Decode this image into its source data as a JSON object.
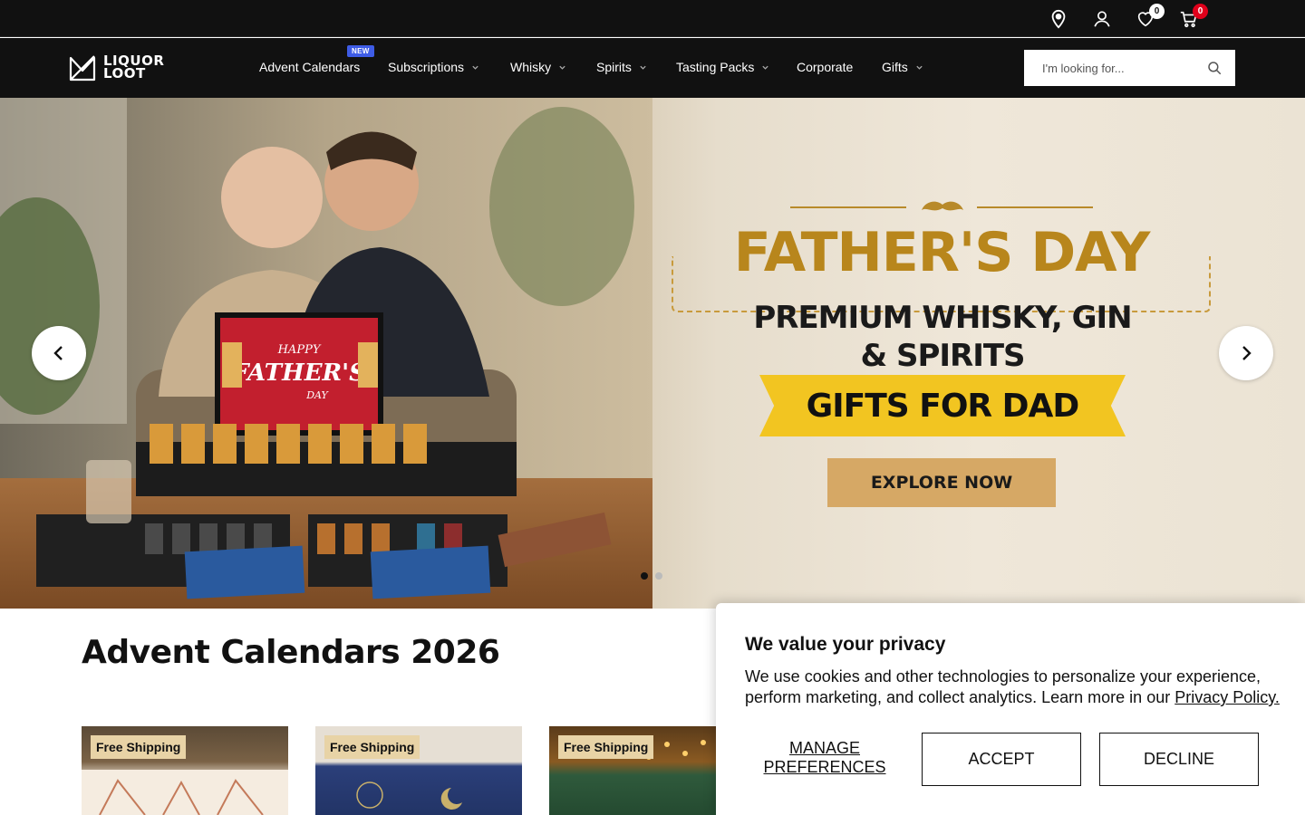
{
  "utility_bar": {
    "wishlist_count": "0",
    "cart_count": "0",
    "icons": [
      "location-icon",
      "account-icon",
      "heart-icon",
      "cart-icon"
    ]
  },
  "nav": {
    "logo_line1": "LIQUOR",
    "logo_line2": "LOOT",
    "new_badge": "NEW",
    "items": [
      {
        "label": "Advent Calendars",
        "has_dropdown": false
      },
      {
        "label": "Subscriptions",
        "has_dropdown": true
      },
      {
        "label": "Whisky",
        "has_dropdown": true
      },
      {
        "label": "Spirits",
        "has_dropdown": true
      },
      {
        "label": "Tasting Packs",
        "has_dropdown": true
      },
      {
        "label": "Corporate",
        "has_dropdown": false
      },
      {
        "label": "Gifts",
        "has_dropdown": true
      }
    ],
    "search_placeholder": "I'm looking for..."
  },
  "hero": {
    "title": "FATHER'S DAY",
    "subtitle_line1": "PREMIUM WHISKY, GIN",
    "subtitle_line2": "& SPIRITS",
    "banner": "GIFTS FOR DAD",
    "cta": "EXPLORE NOW",
    "box_label_line1": "HAPPY",
    "box_label_line2": "FATHER'S",
    "box_label_line3": "DAY",
    "slide_count": 2,
    "active_slide": 1
  },
  "section": {
    "title": "Advent Calendars 2026",
    "products": [
      {
        "tag": "Free Shipping"
      },
      {
        "tag": "Free Shipping"
      },
      {
        "tag": "Free Shipping"
      }
    ]
  },
  "cookie": {
    "title": "We value your privacy",
    "body": "We use cookies and other technologies to personalize your experience, perform marketing, and collect analytics. Learn more in our ",
    "link": "Privacy Policy.",
    "manage_line1": "MANAGE",
    "manage_line2": "PREFERENCES",
    "accept": "ACCEPT",
    "decline": "DECLINE"
  },
  "colors": {
    "header_bg": "#111111",
    "accent_gold": "#b8861c",
    "banner_yellow": "#f2c521",
    "cart_badge": "#e0001b",
    "new_badge": "#3e5ce6"
  }
}
